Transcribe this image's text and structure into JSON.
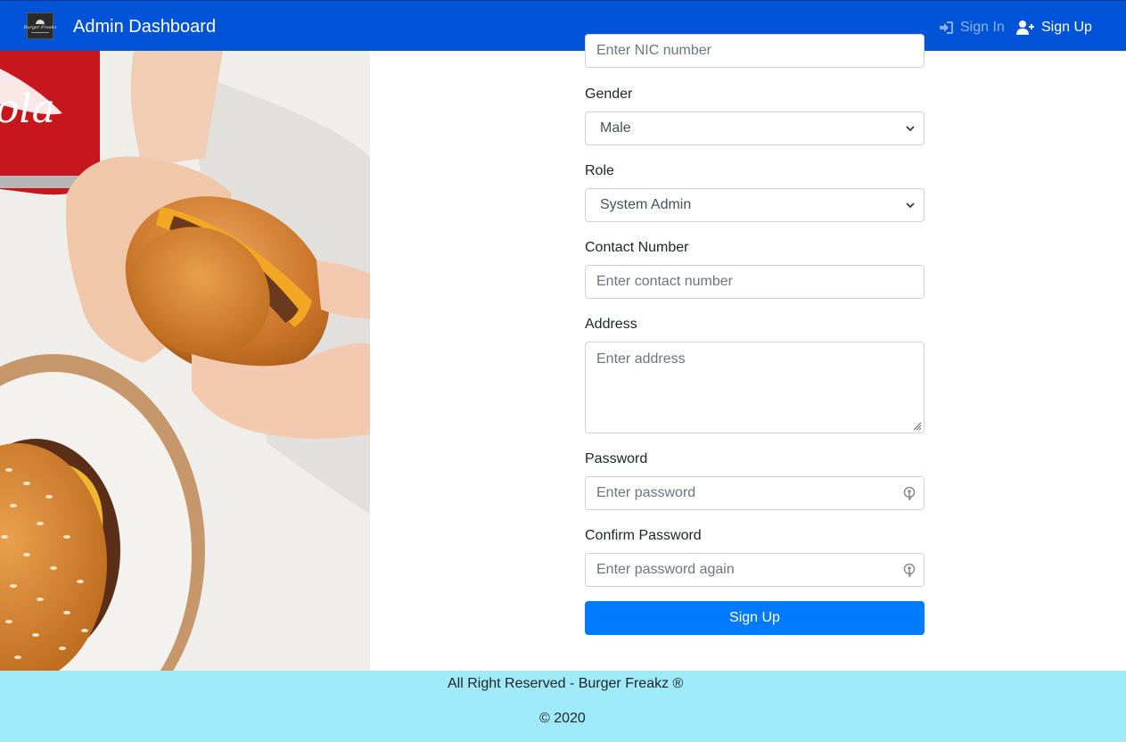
{
  "navbar": {
    "logo_text": "Burger Freakz",
    "title": "Admin Dashboard",
    "signin_label": "Sign In",
    "signup_label": "Sign Up",
    "bg_color": "#0053d6"
  },
  "form": {
    "nic_placeholder": "Enter NIC number",
    "gender_label": "Gender",
    "gender_value": "Male",
    "role_label": "Role",
    "role_value": "System Admin",
    "contact_label": "Contact Number",
    "contact_placeholder": "Enter contact number",
    "address_label": "Address",
    "address_placeholder": "Enter address",
    "password_label": "Password",
    "password_placeholder": "Enter password",
    "confirm_label": "Confirm Password",
    "confirm_placeholder": "Enter password again",
    "submit_label": "Sign Up",
    "button_color": "#007bff"
  },
  "footer": {
    "line1": "All Right Reserved - Burger Freakz ®",
    "line2": "© 2020",
    "bg_color": "#9eeaf9"
  },
  "icons": {
    "signin": "sign-in-icon",
    "signup": "user-plus-icon",
    "password_toggle": "key-icon"
  }
}
